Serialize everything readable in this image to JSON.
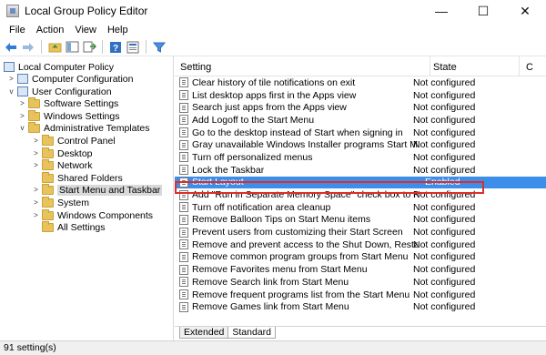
{
  "window": {
    "title": "Local Group Policy Editor",
    "controls": [
      "—",
      "☐",
      "✕"
    ]
  },
  "menubar": [
    "File",
    "Action",
    "View",
    "Help"
  ],
  "toolbar": {
    "icons": [
      "back-arrow-icon",
      "forward-arrow-icon",
      "up-folder-icon",
      "show-hide-tree-icon",
      "export-list-icon",
      "help-icon",
      "properties-icon",
      "filter-icon"
    ]
  },
  "tree": {
    "items": [
      {
        "label": "Local Computer Policy",
        "expander": "",
        "icon": "policy-icon"
      },
      {
        "label": "Computer Configuration",
        "expander": ">",
        "icon": "computer-icon"
      },
      {
        "label": "User Configuration",
        "expander": "v",
        "icon": "user-icon"
      },
      {
        "label": "Software Settings",
        "expander": ">",
        "icon": "folder-icon"
      },
      {
        "label": "Windows Settings",
        "expander": ">",
        "icon": "folder-icon"
      },
      {
        "label": "Administrative Templates",
        "expander": "v",
        "icon": "folder-icon"
      },
      {
        "label": "Control Panel",
        "expander": ">",
        "icon": "folder-icon"
      },
      {
        "label": "Desktop",
        "expander": ">",
        "icon": "folder-icon"
      },
      {
        "label": "Network",
        "expander": ">",
        "icon": "folder-icon"
      },
      {
        "label": "Shared Folders",
        "expander": "",
        "icon": "folder-icon"
      },
      {
        "label": "Start Menu and Taskbar",
        "expander": ">",
        "icon": "folder-icon"
      },
      {
        "label": "System",
        "expander": ">",
        "icon": "folder-icon"
      },
      {
        "label": "Windows Components",
        "expander": ">",
        "icon": "folder-icon"
      },
      {
        "label": "All Settings",
        "expander": "",
        "icon": "settings-icon"
      }
    ]
  },
  "columns": {
    "setting": "Setting",
    "state": "State",
    "comment": "C"
  },
  "rows": [
    {
      "name": "Clear history of tile notifications on exit",
      "state": "Not configured"
    },
    {
      "name": "List desktop apps first in the Apps view",
      "state": "Not configured"
    },
    {
      "name": "Search just apps from the Apps view",
      "state": "Not configured"
    },
    {
      "name": "Add Logoff to the Start Menu",
      "state": "Not configured"
    },
    {
      "name": "Go to the desktop instead of Start when signing in",
      "state": "Not configured"
    },
    {
      "name": "Gray unavailable Windows Installer programs Start Menu...",
      "state": "Not configured"
    },
    {
      "name": "Turn off personalized menus",
      "state": "Not configured"
    },
    {
      "name": "Lock the Taskbar",
      "state": "Not configured"
    },
    {
      "name": "Start Layout",
      "state": "Enabled"
    },
    {
      "name": "Add \"Run in Separate Memory Space\" check box to Run ...",
      "state": "Not configured"
    },
    {
      "name": "Turn off notification area cleanup",
      "state": "Not configured"
    },
    {
      "name": "Remove Balloon Tips on Start Menu items",
      "state": "Not configured"
    },
    {
      "name": "Prevent users from customizing their Start Screen",
      "state": "Not configured"
    },
    {
      "name": "Remove and prevent access to the Shut Down, Restart, Sl...",
      "state": "Not configured"
    },
    {
      "name": "Remove common program groups from Start Menu",
      "state": "Not configured"
    },
    {
      "name": "Remove Favorites menu from Start Menu",
      "state": "Not configured"
    },
    {
      "name": "Remove Search link from Start Menu",
      "state": "Not configured"
    },
    {
      "name": "Remove frequent programs list from the Start Menu",
      "state": "Not configured"
    },
    {
      "name": "Remove Games link from Start Menu",
      "state": "Not configured"
    }
  ],
  "selected_row_index": 8,
  "tabs": [
    "Extended",
    "Standard"
  ],
  "active_tab": "Standard",
  "status": "91 setting(s)",
  "colors": {
    "selection": "#3d8ee8",
    "highlight_border": "#d9302c",
    "folder": "#e8c25a"
  }
}
